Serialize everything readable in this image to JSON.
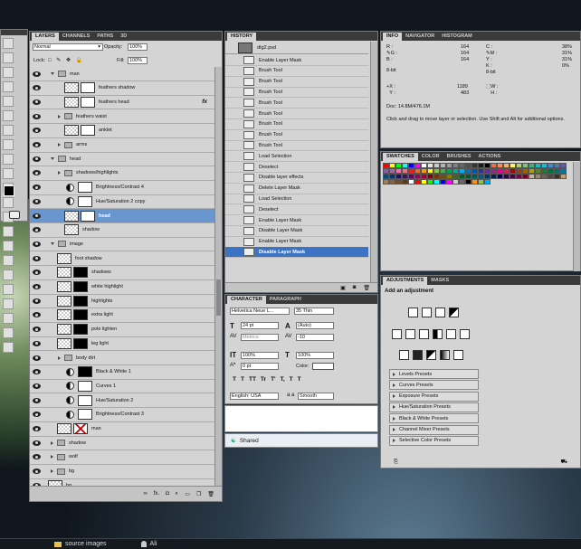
{
  "layers_panel": {
    "tabs": [
      "LAYERS",
      "CHANNELS",
      "PATHS",
      "3D"
    ],
    "blend_mode": "Normal",
    "opacity_label": "Opacity:",
    "opacity_value": "100%",
    "lock_label": "Lock:",
    "fill_label": "Fill:",
    "fill_value": "100%",
    "layers": [
      {
        "name": "man",
        "kind": "group"
      },
      {
        "name": "feathers shadow",
        "kind": "layer"
      },
      {
        "name": "feathers head",
        "kind": "layer",
        "fx": "fx"
      },
      {
        "name": "feathers waist",
        "kind": "group"
      },
      {
        "name": "anklet",
        "kind": "layer"
      },
      {
        "name": "arms",
        "kind": "group"
      },
      {
        "name": "head",
        "kind": "group"
      },
      {
        "name": "shadows/highlights",
        "kind": "group"
      },
      {
        "name": "Brightness/Contrast 4",
        "kind": "adj"
      },
      {
        "name": "Hue/Saturation 2 copy",
        "kind": "adj"
      },
      {
        "name": "head",
        "kind": "layer",
        "selected": true
      },
      {
        "name": "shadow",
        "kind": "layer"
      },
      {
        "name": "image",
        "kind": "group"
      },
      {
        "name": "foot shadow",
        "kind": "layer"
      },
      {
        "name": "shadows",
        "kind": "layer"
      },
      {
        "name": "white highlight",
        "kind": "layer"
      },
      {
        "name": "highlights",
        "kind": "layer"
      },
      {
        "name": "extra light",
        "kind": "layer"
      },
      {
        "name": "pole lighten",
        "kind": "layer"
      },
      {
        "name": "leg light",
        "kind": "layer"
      },
      {
        "name": "body dirt",
        "kind": "group"
      },
      {
        "name": "Black & White 1",
        "kind": "adj"
      },
      {
        "name": "Curves 1",
        "kind": "adj"
      },
      {
        "name": "Hue/Saturation 2",
        "kind": "adj"
      },
      {
        "name": "Brightness/Contrast 3",
        "kind": "adj"
      },
      {
        "name": "man",
        "kind": "layer"
      },
      {
        "name": "shadow",
        "kind": "group"
      },
      {
        "name": "wolf",
        "kind": "group"
      },
      {
        "name": "bg",
        "kind": "group"
      },
      {
        "name": "bg",
        "kind": "layer"
      }
    ],
    "footer_fx": "fx."
  },
  "history_panel": {
    "tab": "HISTORY",
    "snapshot": "dtg2.psd",
    "items": [
      "Enable Layer Mask",
      "Brush Tool",
      "Brush Tool",
      "Brush Tool",
      "Brush Tool",
      "Brush Tool",
      "Brush Tool",
      "Brush Tool",
      "Brush Tool",
      "Load Selection",
      "Deselect",
      "Disable layer effects",
      "Delete Layer Mask",
      "Load Selection",
      "Deselect",
      "Enable Layer Mask",
      "Disable Layer Mask",
      "Enable Layer Mask",
      "Disable Layer Mask"
    ],
    "selected_index": 18
  },
  "character_panel": {
    "tabs": [
      "CHARACTER",
      "PARAGRAPH"
    ],
    "font_family": "Helvetica Neue L...",
    "font_style": "35 Thin",
    "font_size": "24 pt",
    "leading": "(Auto)",
    "kerning": "Metrics",
    "tracking": "-10",
    "vscale": "100%",
    "hscale": "100%",
    "baseline": "0 pt",
    "color_label": "Color:",
    "style_buttons": [
      "T",
      "T",
      "TT",
      "Tr",
      "T'",
      "T,",
      "T",
      "T"
    ],
    "language": "English: USA",
    "aa_label": "a a",
    "antialias": "Smooth"
  },
  "shared_bar": {
    "label": "Shared"
  },
  "info_panel": {
    "tabs": [
      "INFO",
      "NAVIGATOR",
      "HISTOGRAM"
    ],
    "rgb": [
      {
        "l": "R :",
        "v": "164"
      },
      {
        "l": "G :",
        "v": "164"
      },
      {
        "l": "B :",
        "v": "164"
      }
    ],
    "cmyk": [
      {
        "l": "C :",
        "v": "38%"
      },
      {
        "l": "M :",
        "v": "31%"
      },
      {
        "l": "Y :",
        "v": "31%"
      },
      {
        "l": "K :",
        "v": "0%"
      }
    ],
    "bit_left": "8-bit",
    "bit_right": "8-bit",
    "x_label": "X :",
    "x_value": "1189",
    "y_label": "Y :",
    "y_value": "483",
    "w_label": "W :",
    "h_label": "H :",
    "doc": "Doc: 14.8M/476.1M",
    "hint": "Click and drag to move layer or selection.  Use Shift and Alt for additional options."
  },
  "swatches_panel": {
    "tabs": [
      "SWATCHES",
      "COLOR",
      "BRUSHES",
      "ACTIONS"
    ],
    "colors": [
      "#ff0000",
      "#ffff00",
      "#00ff00",
      "#00ffff",
      "#0000ff",
      "#ff00ff",
      "#ffffff",
      "#e6e6e6",
      "#cccccc",
      "#b3b3b3",
      "#999999",
      "#808080",
      "#666666",
      "#4d4d4d",
      "#333333",
      "#1a1a1a",
      "#000000",
      "#f26c4f",
      "#f68e55",
      "#fbaf5c",
      "#fff467",
      "#acd372",
      "#7cc576",
      "#3bb878",
      "#1abbb4",
      "#00bff3",
      "#438ccb",
      "#5574b9",
      "#605ca8",
      "#855fa8",
      "#a763a8",
      "#f06ea9",
      "#f26d7d",
      "#ed1c24",
      "#f26522",
      "#f7941d",
      "#fff200",
      "#8dc73f",
      "#39b54a",
      "#00a651",
      "#00a99d",
      "#00aeef",
      "#0072bc",
      "#0054a6",
      "#2e3192",
      "#662d91",
      "#92278f",
      "#ec008c",
      "#ed145b",
      "#9e0b0f",
      "#a0410d",
      "#a36209",
      "#aba000",
      "#598527",
      "#1a7b30",
      "#007236",
      "#00746b",
      "#0076a3",
      "#004a80",
      "#003471",
      "#1b1464",
      "#440e62",
      "#630460",
      "#9e005d",
      "#9e0039",
      "#790000",
      "#7b2e00",
      "#7d4900",
      "#827b00",
      "#406618",
      "#005e20",
      "#005826",
      "#005952",
      "#005b7f",
      "#003663",
      "#002157",
      "#0d004c",
      "#32004b",
      "#4b0049",
      "#7b0046",
      "#7a0026",
      "#c7b299",
      "#998675",
      "#736357",
      "#534741",
      "#37302d",
      "#c69c6d",
      "#a67c52",
      "#8c6239",
      "#754c24",
      "#603913",
      "#ffffff",
      "#ff0000",
      "#ffff00",
      "#00ff00",
      "#00ffff",
      "#0000ff",
      "#ff00ff",
      "#cccccc",
      "#666666",
      "#000000",
      "#f7941d",
      "#8dc73f",
      "#00aeef"
    ]
  },
  "adjustments_panel": {
    "tabs": [
      "ADJUSTMENTS",
      "MASKS"
    ],
    "title": "Add an adjustment",
    "presets": [
      "Levels Presets",
      "Curves Presets",
      "Exposure Presets",
      "Hue/Saturation Presets",
      "Black & White Presets",
      "Channel Mixer Presets",
      "Selective Color Presets"
    ]
  },
  "taskbar": {
    "items": [
      {
        "label": "source images"
      },
      {
        "label": "Ali"
      }
    ]
  }
}
